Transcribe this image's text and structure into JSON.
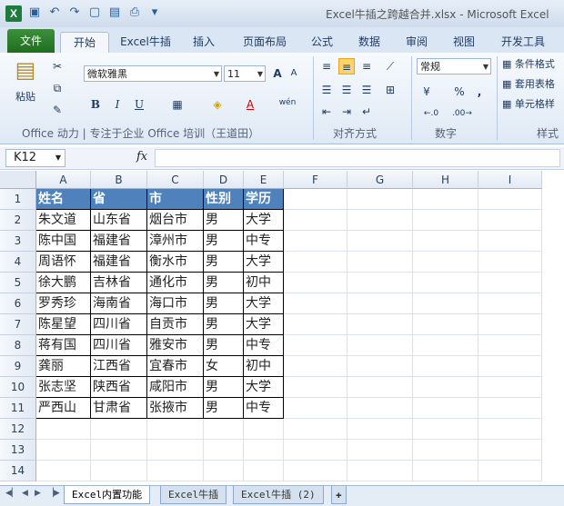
{
  "window": {
    "title": "Excel牛插之跨越合并.xlsx - Microsoft Excel",
    "app_icon": "X"
  },
  "qat": {
    "icons": [
      "save-icon",
      "undo-icon",
      "redo-icon",
      "new-icon",
      "open-icon",
      "print-preview-icon",
      "customize-icon"
    ]
  },
  "tabs": [
    "文件",
    "开始",
    "Excel牛插",
    "插入",
    "页面布局",
    "公式",
    "数据",
    "审阅",
    "视图",
    "开发工具"
  ],
  "ribbon": {
    "paste_label": "粘贴",
    "font_name": "微软雅黑",
    "font_size": "11",
    "number_format": "常规",
    "styles": [
      "条件格式",
      "套用表格",
      "单元格样"
    ],
    "group_clipboard_label": "Office 动力 | 专注于企业 Office 培训（王道田）",
    "group_alignment_label": "对齐方式",
    "group_number_label": "数字",
    "group_styles_label": "样式",
    "glyphs": {
      "bold": "B",
      "italic": "I",
      "underline": "U",
      "grow": "A",
      "shrink": "A",
      "font_color": "A",
      "pct": "%",
      "comma": ",",
      "inc": "←.0",
      "dec": ".00→",
      "wen": "wén"
    }
  },
  "formula_bar": {
    "name_box": "K12",
    "fx": "fx",
    "value": ""
  },
  "columns": [
    "A",
    "B",
    "C",
    "D",
    "E",
    "F",
    "G",
    "H",
    "I"
  ],
  "rows": [
    "1",
    "2",
    "3",
    "4",
    "5",
    "6",
    "7",
    "8",
    "9",
    "10",
    "11",
    "12",
    "13",
    "14"
  ],
  "table": {
    "header": [
      "姓名",
      "省",
      "市",
      "性别",
      "学历"
    ],
    "rows": [
      [
        "朱文道",
        "山东省",
        "烟台市",
        "男",
        "大学"
      ],
      [
        "陈中国",
        "福建省",
        "漳州市",
        "男",
        "中专"
      ],
      [
        "周语怀",
        "福建省",
        "衡水市",
        "男",
        "大学"
      ],
      [
        "徐大鹏",
        "吉林省",
        "通化市",
        "男",
        "初中"
      ],
      [
        "罗秀珍",
        "海南省",
        "海口市",
        "男",
        "大学"
      ],
      [
        "陈星望",
        "四川省",
        "自贡市",
        "男",
        "大学"
      ],
      [
        "蒋有国",
        "四川省",
        "雅安市",
        "男",
        "中专"
      ],
      [
        "龚丽",
        "江西省",
        "宜春市",
        "女",
        "初中"
      ],
      [
        "张志坚",
        "陕西省",
        "咸阳市",
        "男",
        "大学"
      ],
      [
        "严西山",
        "甘肃省",
        "张掖市",
        "男",
        "中专"
      ]
    ]
  },
  "sheets": [
    "Excel内置功能",
    "Excel牛插",
    "Excel牛插 (2)"
  ],
  "colors": {
    "header_fill": "#4f81bd",
    "file_tab": "#2f7f2f"
  }
}
